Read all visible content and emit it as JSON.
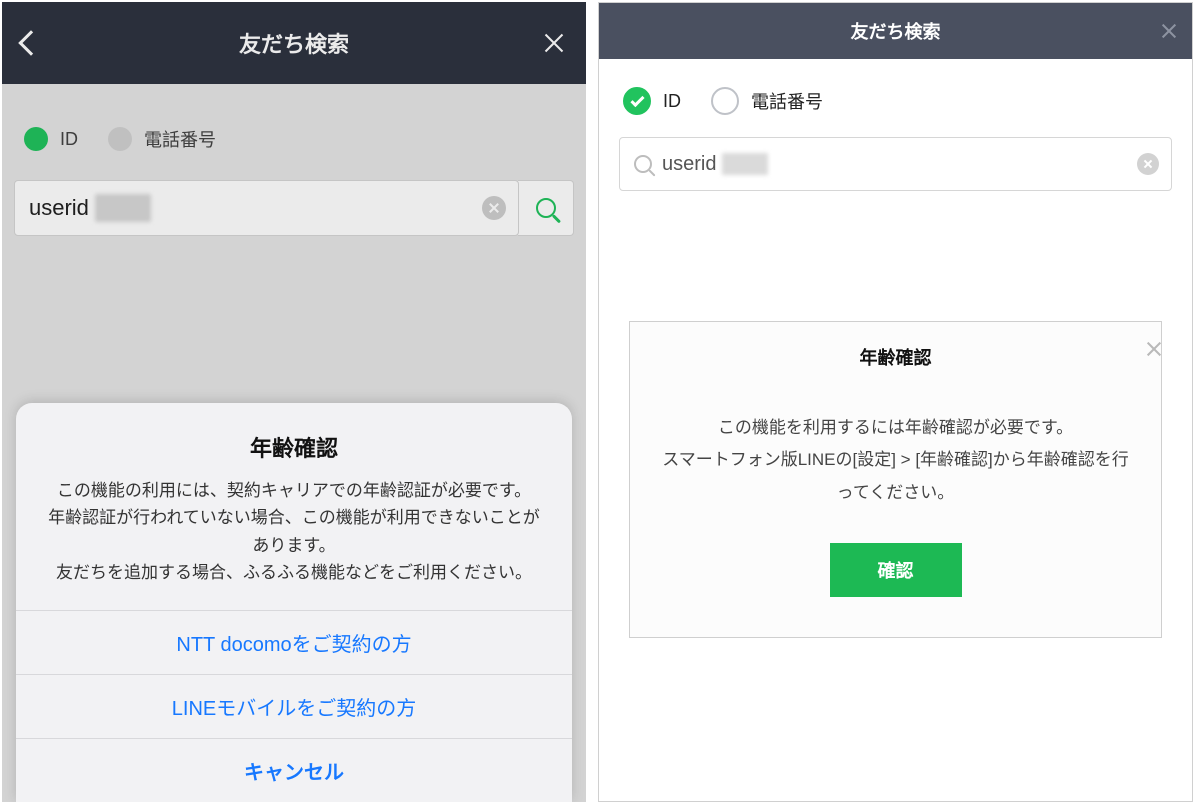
{
  "left": {
    "header_title": "友だち検索",
    "radio_id": "ID",
    "radio_phone": "電話番号",
    "search_value": "userid",
    "sheet": {
      "title": "年齢確認",
      "message": "この機能の利用には、契約キャリアでの年齢認証が必要です。\n年齢認証が行われていない場合、この機能が利用できないことがあります。\n友だちを追加する場合、ふるふる機能などをご利用ください。",
      "option_docomo": "NTT docomoをご契約の方",
      "option_line": "LINEモバイルをご契約の方",
      "cancel": "キャンセル"
    }
  },
  "right": {
    "header_title": "友だち検索",
    "radio_id": "ID",
    "radio_phone": "電話番号",
    "search_value": "userid",
    "dialog": {
      "title": "年齢確認",
      "message": "この機能を利用するには年齢確認が必要です。\nスマートフォン版LINEの[設定] > [年齢確認]から年齢確認を行ってください。",
      "confirm": "確認"
    }
  }
}
